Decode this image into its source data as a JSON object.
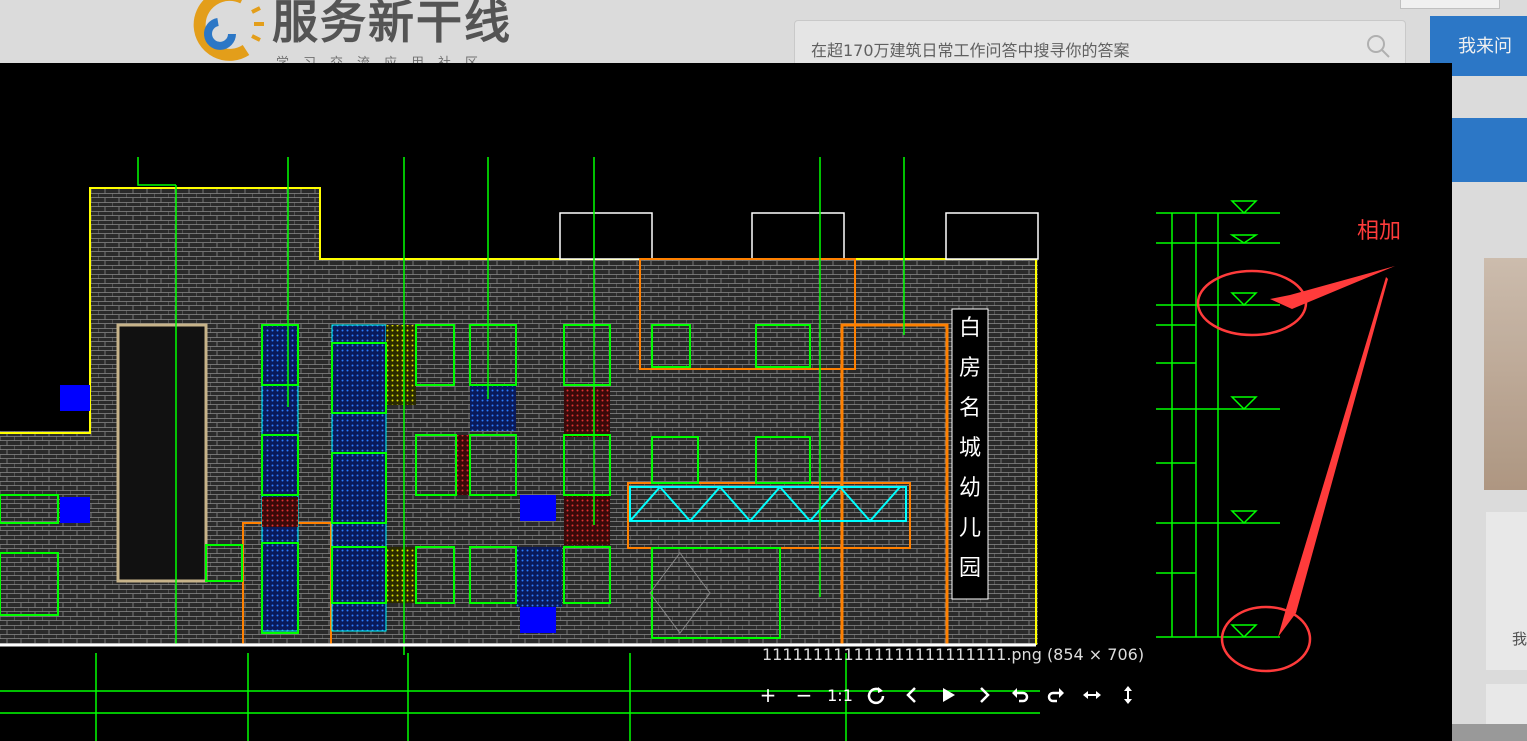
{
  "site": {
    "logo_text": "服务新干线",
    "logo_sub": "学习交流应用社区",
    "search_placeholder": "在超170万建筑日常工作问答中搜寻你的答案",
    "ask_button": "我来问",
    "card_text": "我"
  },
  "viewer": {
    "caption": "111111111111111111111111.png (854 × 706)",
    "toolbar": {
      "zoom_in": "+",
      "zoom_out": "−",
      "actual_size": "1:1"
    },
    "annotation": "相加",
    "vertical_label": "白房名城幼儿园"
  },
  "colors": {
    "annotation_red": "#ff3b3b",
    "cad_green": "#00ff00",
    "cad_yellow": "#ffff00",
    "cad_orange": "#ff8000",
    "cad_cyan": "#00ffff",
    "brand_blue": "#2f7fd3"
  }
}
